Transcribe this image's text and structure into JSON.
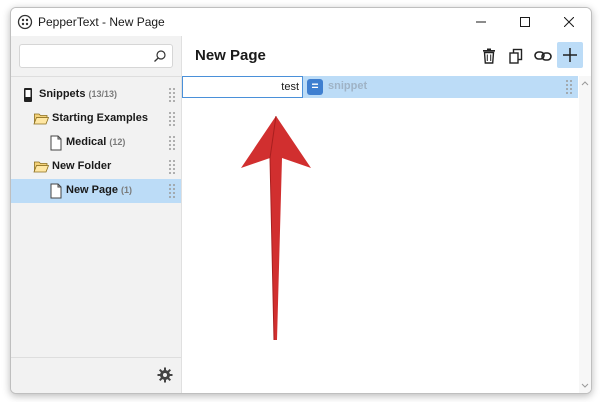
{
  "window": {
    "title": "PepperText - New Page"
  },
  "sidebar": {
    "search": {
      "placeholder": "",
      "value": ""
    },
    "tree": [
      {
        "label": "Snippets",
        "count": "(13/13)",
        "icon": "phone-icon",
        "level": 0,
        "selected": false
      },
      {
        "label": "Starting Examples",
        "count": "",
        "icon": "folder-open-icon",
        "level": 1,
        "selected": false
      },
      {
        "label": "Medical",
        "count": "(12)",
        "icon": "document-icon",
        "level": 2,
        "selected": false
      },
      {
        "label": "New Folder",
        "count": "",
        "icon": "folder-open-icon",
        "level": 1,
        "selected": false
      },
      {
        "label": "New Page",
        "count": "(1)",
        "icon": "document-icon",
        "level": 2,
        "selected": true
      }
    ]
  },
  "main": {
    "page_title": "New Page",
    "toolbar": {
      "icons": [
        "trash-icon",
        "copy-icon",
        "link-icon",
        "plus-icon"
      ]
    },
    "snippet": {
      "abbreviation": "test",
      "separator": "=",
      "placeholder": "snippet"
    }
  },
  "colors": {
    "selection": "#bcdcf7",
    "accent": "#3f7fd0",
    "annotation_arrow": "#d12f2f"
  }
}
